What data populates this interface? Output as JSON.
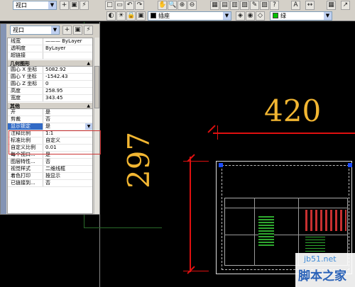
{
  "toolbar": {
    "viewport_combo": "视口",
    "layer_combo": "插座",
    "color_combo": "绿",
    "icons": [
      "new-icon",
      "open-icon",
      "save-icon",
      "print-icon",
      "undo-icon",
      "redo-icon",
      "pan-icon",
      "zoom-icon",
      "properties-icon",
      "layer-icon"
    ]
  },
  "properties": {
    "object_type": "视口",
    "sections": [
      {
        "name": "",
        "rows": [
          {
            "key": "线宽",
            "value": "——— ByLayer"
          },
          {
            "key": "透明度",
            "value": "ByLayer"
          },
          {
            "key": "超链接",
            "value": ""
          }
        ]
      },
      {
        "name": "几何图形",
        "rows": [
          {
            "key": "圆心 X 坐标",
            "value": "5082.92"
          },
          {
            "key": "圆心 Y 坐标",
            "value": "-1542.43"
          },
          {
            "key": "圆心 Z 坐标",
            "value": "0"
          },
          {
            "key": "高度",
            "value": "258.95"
          },
          {
            "key": "宽度",
            "value": "343.45"
          }
        ]
      },
      {
        "name": "其他",
        "rows": [
          {
            "key": "开",
            "value": "是"
          },
          {
            "key": "剪裁",
            "value": "否"
          },
          {
            "key": "显示锁定",
            "value": "是",
            "selected": true
          },
          {
            "key": "注释比例",
            "value": "1:1"
          },
          {
            "key": "标准比例",
            "value": "自定义"
          },
          {
            "key": "自定义比例",
            "value": "0.01"
          },
          {
            "key": "每个视口...",
            "value": "是"
          },
          {
            "key": "图层特性...",
            "value": "否"
          },
          {
            "key": "视觉样式",
            "value": "二维线框"
          },
          {
            "key": "着色打印",
            "value": "按显示"
          },
          {
            "key": "已链接到...",
            "value": "否"
          }
        ]
      }
    ]
  },
  "drawing": {
    "dim_horizontal": "420",
    "dim_vertical": "297"
  },
  "watermark": {
    "site": "jb51.net",
    "name": "脚本之家"
  },
  "colors": {
    "dimension": "#f2b632",
    "dimension_line": "#e01010",
    "grip": "#1a4cff",
    "selection_row": "#316ac5"
  }
}
